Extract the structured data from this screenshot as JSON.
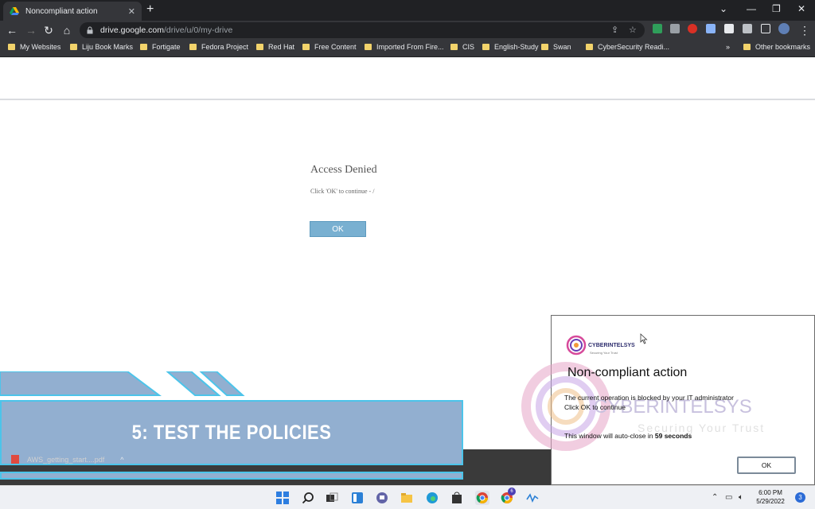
{
  "browser": {
    "tab": {
      "title": "Noncompliant action",
      "close_glyph": "✕",
      "favicon": "google-drive-icon"
    },
    "new_tab_glyph": "+",
    "window_controls": {
      "minimize": "—",
      "restore": "❐",
      "close": "✕",
      "tabsearch": "⌄"
    },
    "nav": {
      "back": "←",
      "forward": "→",
      "reload": "↻",
      "home": "⌂"
    },
    "address": {
      "host": "drive.google.com",
      "path": "/drive/u/0/my-drive"
    }
  },
  "bookmarks": {
    "items": [
      "My Websites",
      "Liju Book Marks",
      "Fortigate",
      "Fedora Project",
      "Red Hat",
      "Free Content",
      "Imported From Fire...",
      "CIS",
      "English-Study",
      "Swan",
      "CyberSecurity Readi..."
    ],
    "overflow": "»",
    "other": "Other bookmarks"
  },
  "page": {
    "title": "Access Denied",
    "message": "Click 'OK' to continue - /",
    "ok_label": "OK"
  },
  "banner": {
    "heading": "5: TEST THE POLICIES"
  },
  "download": {
    "filename": "AWS_getting_start....pdf",
    "chevron": "^"
  },
  "popup": {
    "brand_name": "CYBERINTELSYS",
    "brand_tagline": "Securing Your Trust",
    "title": "Non-compliant action",
    "message_line1": "The current operation is blocked by your IT administrator",
    "message_line2": "Click OK to continue",
    "autoclose_prefix": "This window will auto-close in",
    "autoclose_value": "59 seconds",
    "ok_label": "OK",
    "watermark_name": "CYBERINTELSYS",
    "watermark_tagline": "Securing Your Trust"
  },
  "taskbar": {
    "time": "6:00 PM",
    "date": "5/29/2022",
    "notification_count": "3",
    "edge_badge": "6"
  },
  "colors": {
    "chrome_dark": "#202124",
    "chrome_toolbar": "#35363a",
    "ok_button": "#79b0d1",
    "banner_fill": "#92afd0",
    "banner_border": "#4cc4ea"
  }
}
